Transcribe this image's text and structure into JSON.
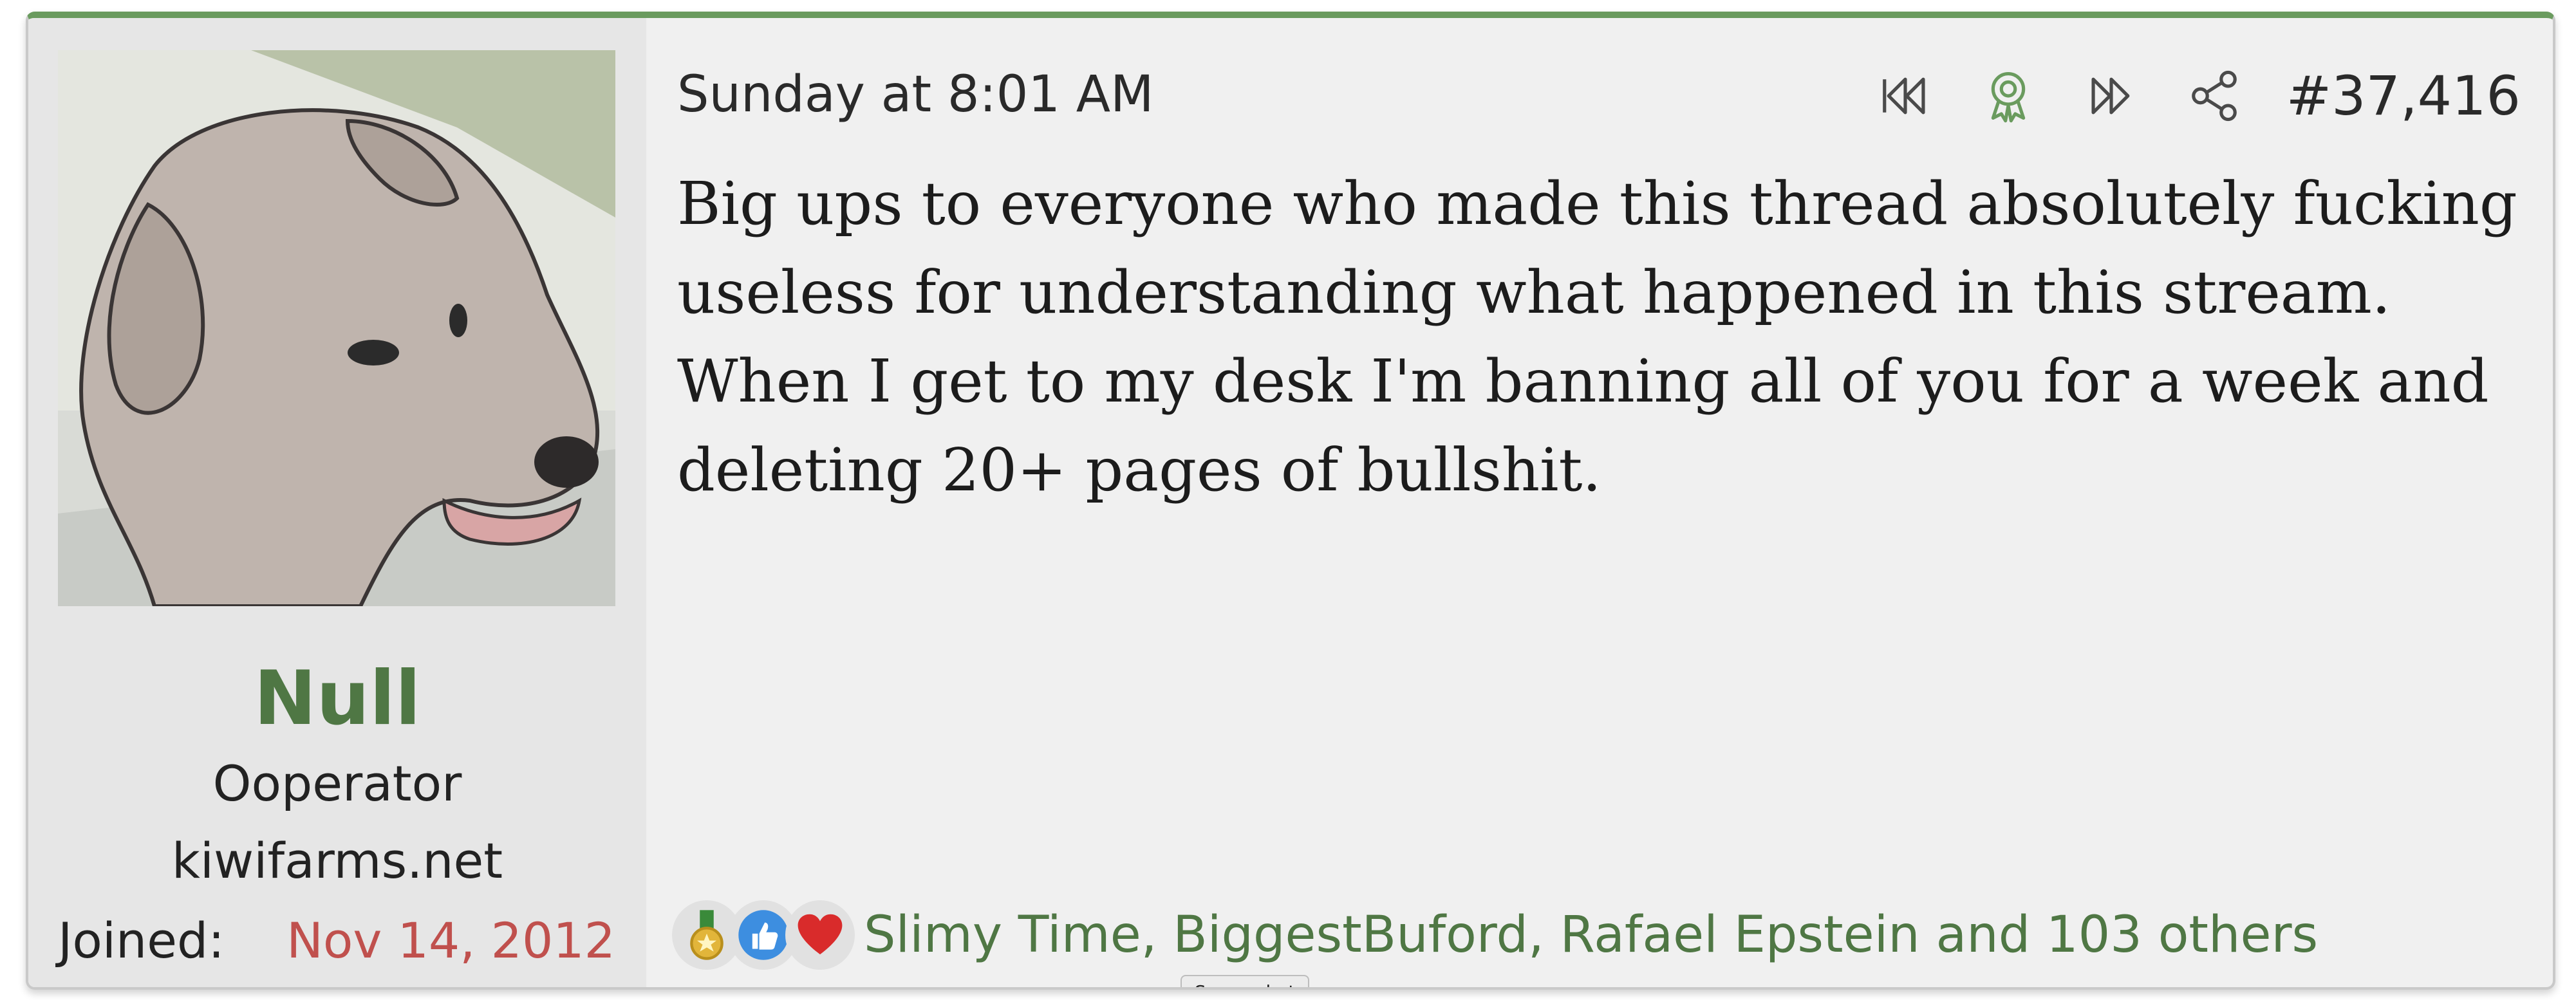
{
  "user": {
    "name": "Null",
    "title": "Ooperator",
    "site": "kiwifarms.net",
    "joined_label": "Joined:",
    "joined_value": "Nov 14, 2012"
  },
  "post": {
    "date": "Sunday at 8:01 AM",
    "number": "#37,416",
    "body": "Big ups to everyone who made this thread absolutely fucking useless for understanding what happened in this stream. When I get to my desk I'm banning all of you for a week and deleting 20+ pages of bullshit."
  },
  "actions": {
    "icons": [
      "first-post-icon",
      "award-icon",
      "last-post-icon",
      "share-icon"
    ]
  },
  "reactions": {
    "icons": [
      "medal-icon",
      "thumbs-up-icon",
      "heart-icon"
    ],
    "text": "Slimy Time, BiggestBuford, Rafael Epstein and 103 others"
  },
  "tooltip": {
    "text": "Screenshot"
  },
  "colors": {
    "accent": "#6a9b5e",
    "username": "#4f7744",
    "joined_date": "#c0504d"
  }
}
